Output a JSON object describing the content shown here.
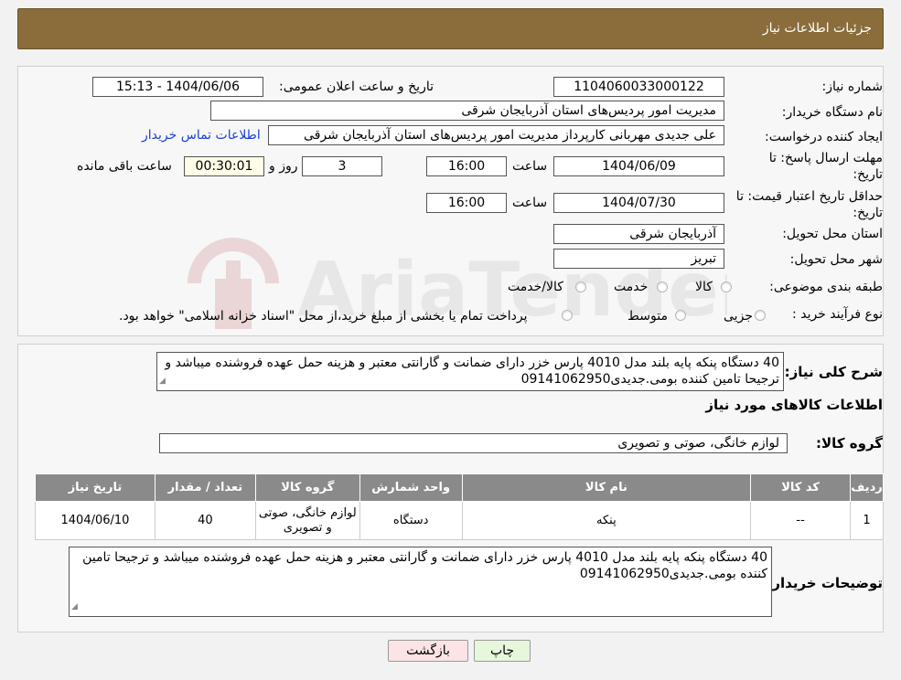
{
  "header": {
    "title": "جزئیات اطلاعات نیاز"
  },
  "info": {
    "need_number_label": "شماره نیاز:",
    "need_number": "1104060033000122",
    "announce_label": "تاریخ و ساعت اعلان عمومی:",
    "announce_value": "1404/06/06 - 15:13",
    "buyer_org_label": "نام دستگاه خریدار:",
    "buyer_org": "مدیریت امور پردیس‌های استان آذربایجان شرقی",
    "requester_label": "ایجاد کننده درخواست:",
    "requester": "علی جدیدی مهربانی کارپرداز مدیریت امور پردیس‌های استان آذربایجان شرقی",
    "contact_link": "اطلاعات تماس خریدار",
    "deadline_label_1": "مهلت ارسال پاسخ: تا",
    "deadline_label_2": "تاریخ:",
    "deadline_date": "1404/06/09",
    "time_label": "ساعت",
    "deadline_time": "16:00",
    "days_value": "3",
    "days_label": "روز و",
    "remaining_time": "00:30:01",
    "remaining_label": "ساعت باقی مانده",
    "validity_label_1": "حداقل تاریخ اعتبار قیمت: تا",
    "validity_label_2": "تاریخ:",
    "validity_date": "1404/07/30",
    "validity_time": "16:00",
    "province_label": "استان محل تحویل:",
    "province": "آذربایجان شرقی",
    "city_label": "شهر محل تحویل:",
    "city": "تبریز",
    "category_label": "طبقه بندی موضوعی:",
    "category_options": [
      "کالا",
      "خدمت",
      "کالا/خدمت"
    ],
    "process_label": "نوع فرآیند خرید :",
    "process_options": [
      "جزیی",
      "متوسط"
    ],
    "process_note": "پرداخت تمام یا بخشی از مبلغ خرید،از محل \"اسناد خزانه اسلامی\" خواهد بود."
  },
  "description": {
    "label": "شرح کلی نیاز:",
    "text": "40 دستگاه پنکه پایه بلند مدل 4010 پارس خزر دارای ضمانت و گارانتی معتبر و هزینه حمل عهده فروشنده میباشد و ترجیحا تامین کننده بومی.جدیدی09141062950"
  },
  "goods": {
    "section_title": "اطلاعات کالاهای مورد نیاز",
    "group_label": "گروه کالا:",
    "group_value": "لوازم خانگی، صوتی و تصویری",
    "columns": [
      "ردیف",
      "کد کالا",
      "نام کالا",
      "واحد شمارش",
      "گروه کالا",
      "تعداد / مقدار",
      "تاریخ نیاز"
    ],
    "rows": [
      {
        "row": "1",
        "code": "--",
        "name": "پنکه",
        "unit": "دستگاه",
        "group": "لوازم خانگی، صوتی و تصویری",
        "qty": "40",
        "date": "1404/06/10"
      }
    ]
  },
  "buyer_notes": {
    "label": "توضیحات خریدار:",
    "text": "40 دستگاه پنکه پایه بلند مدل 4010 پارس خزر دارای ضمانت و گارانتی معتبر و هزینه حمل عهده فروشنده میباشد و ترجیحا تامین کننده بومی.جدیدی09141062950"
  },
  "buttons": {
    "print": "چاپ",
    "back": "بازگشت"
  },
  "watermark": {
    "text": "AriaTender.neT"
  },
  "colors": {
    "header_bg": "#8a6d3b",
    "table_header": "#8a8a8a",
    "print_btn": "#e6f7dc",
    "back_btn": "#fde4e4"
  }
}
